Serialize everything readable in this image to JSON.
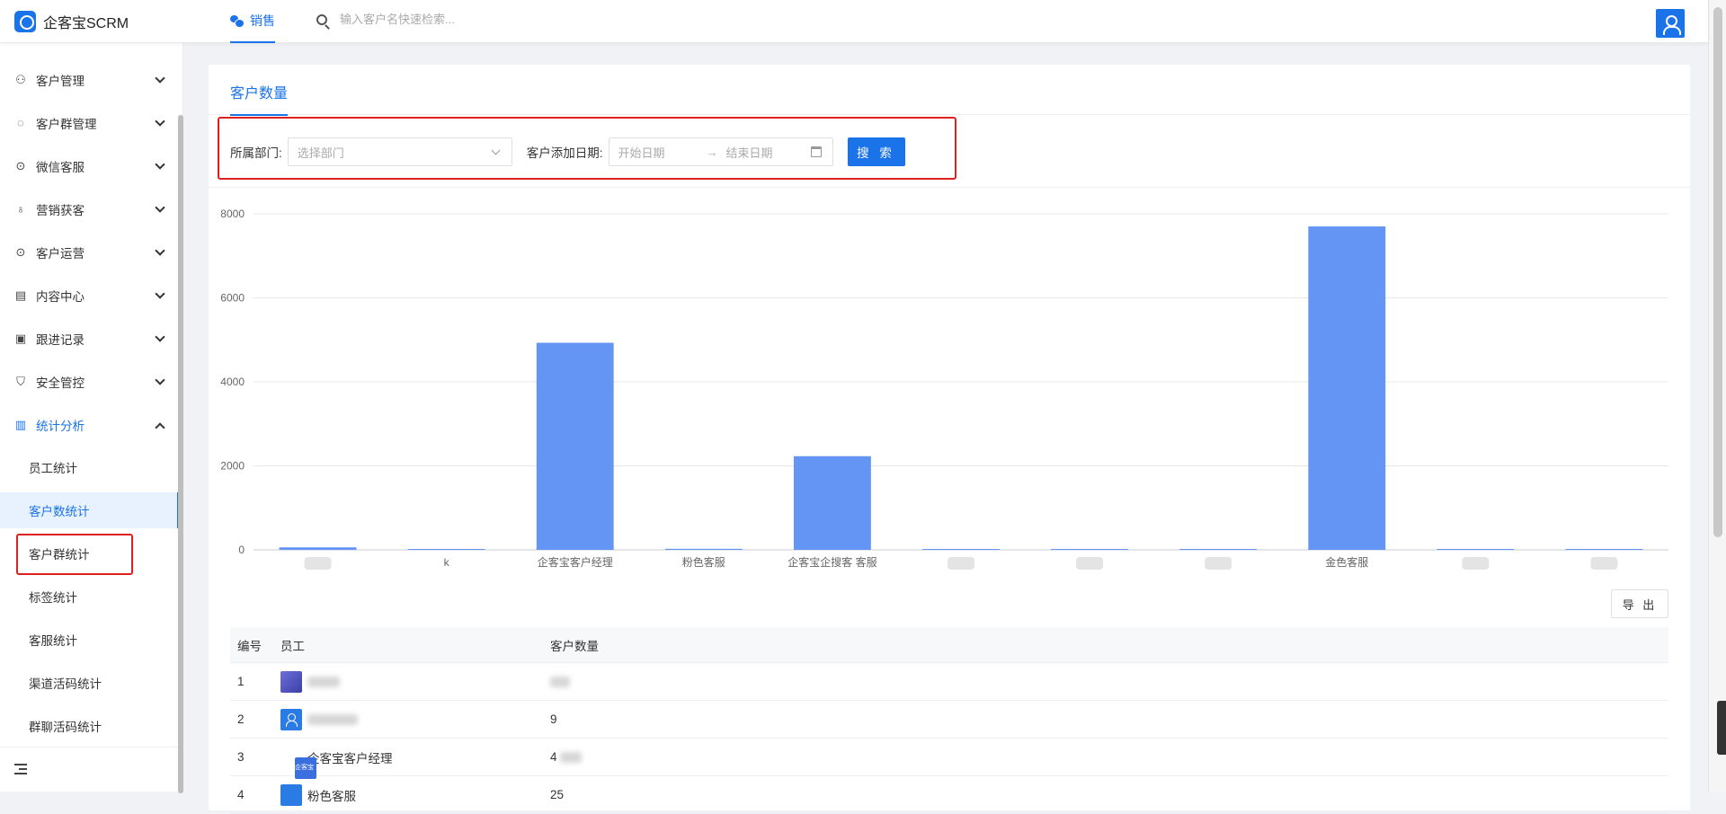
{
  "app": {
    "name": "企客宝SCRM"
  },
  "header": {
    "tab_label": "销售",
    "search_placeholder": "输入客户名快速检索..."
  },
  "sidebar": {
    "menus": [
      {
        "label": "客户管理",
        "icon": "users-icon"
      },
      {
        "label": "客户群管理",
        "icon": "chat-icon"
      },
      {
        "label": "微信客服",
        "icon": "message-icon"
      },
      {
        "label": "营销获客",
        "icon": "bulb-icon"
      },
      {
        "label": "客户运营",
        "icon": "message-icon"
      },
      {
        "label": "内容中心",
        "icon": "content-icon"
      },
      {
        "label": "跟进记录",
        "icon": "record-icon"
      },
      {
        "label": "安全管控",
        "icon": "shield-icon"
      },
      {
        "label": "统计分析",
        "icon": "chart-icon"
      }
    ],
    "sub_items": [
      "员工统计",
      "客户数统计",
      "客户群统计",
      "标签统计",
      "客服统计",
      "渠道活码统计",
      "群聊活码统计"
    ]
  },
  "page": {
    "tab_title": "客户数量",
    "filters": {
      "dept_label": "所属部门:",
      "dept_placeholder": "选择部门",
      "date_label": "客户添加日期:",
      "start_placeholder": "开始日期",
      "arrow": "→",
      "end_placeholder": "结束日期",
      "search_button": "搜 索"
    },
    "export_button": "导 出"
  },
  "chart_data": {
    "type": "bar",
    "color": "#6495f5",
    "ylim": [
      0,
      8000
    ],
    "yticks": [
      0,
      2000,
      4000,
      6000,
      8000
    ],
    "categories": [
      "",
      "k",
      "企客宝客户经理",
      "粉色客服",
      "企客宝企搜客 客服",
      "",
      "",
      "",
      "金色客服",
      "",
      ""
    ],
    "values": [
      60,
      10,
      4930,
      25,
      2230,
      5,
      5,
      10,
      7700,
      5,
      5
    ]
  },
  "table": {
    "headers": {
      "no": "编号",
      "employee": "员工",
      "count": "客户数量"
    },
    "rows": [
      {
        "no": "1",
        "name": "",
        "count": ""
      },
      {
        "no": "2",
        "name": "",
        "count": "9"
      },
      {
        "no": "3",
        "name": "企客宝客户经理",
        "count": "4"
      },
      {
        "no": "4",
        "name": "粉色客服",
        "count": "25"
      }
    ]
  },
  "colors": {
    "accent": "#1a73e8",
    "highlight_box": "#e02020",
    "bar": "#6495f5"
  }
}
